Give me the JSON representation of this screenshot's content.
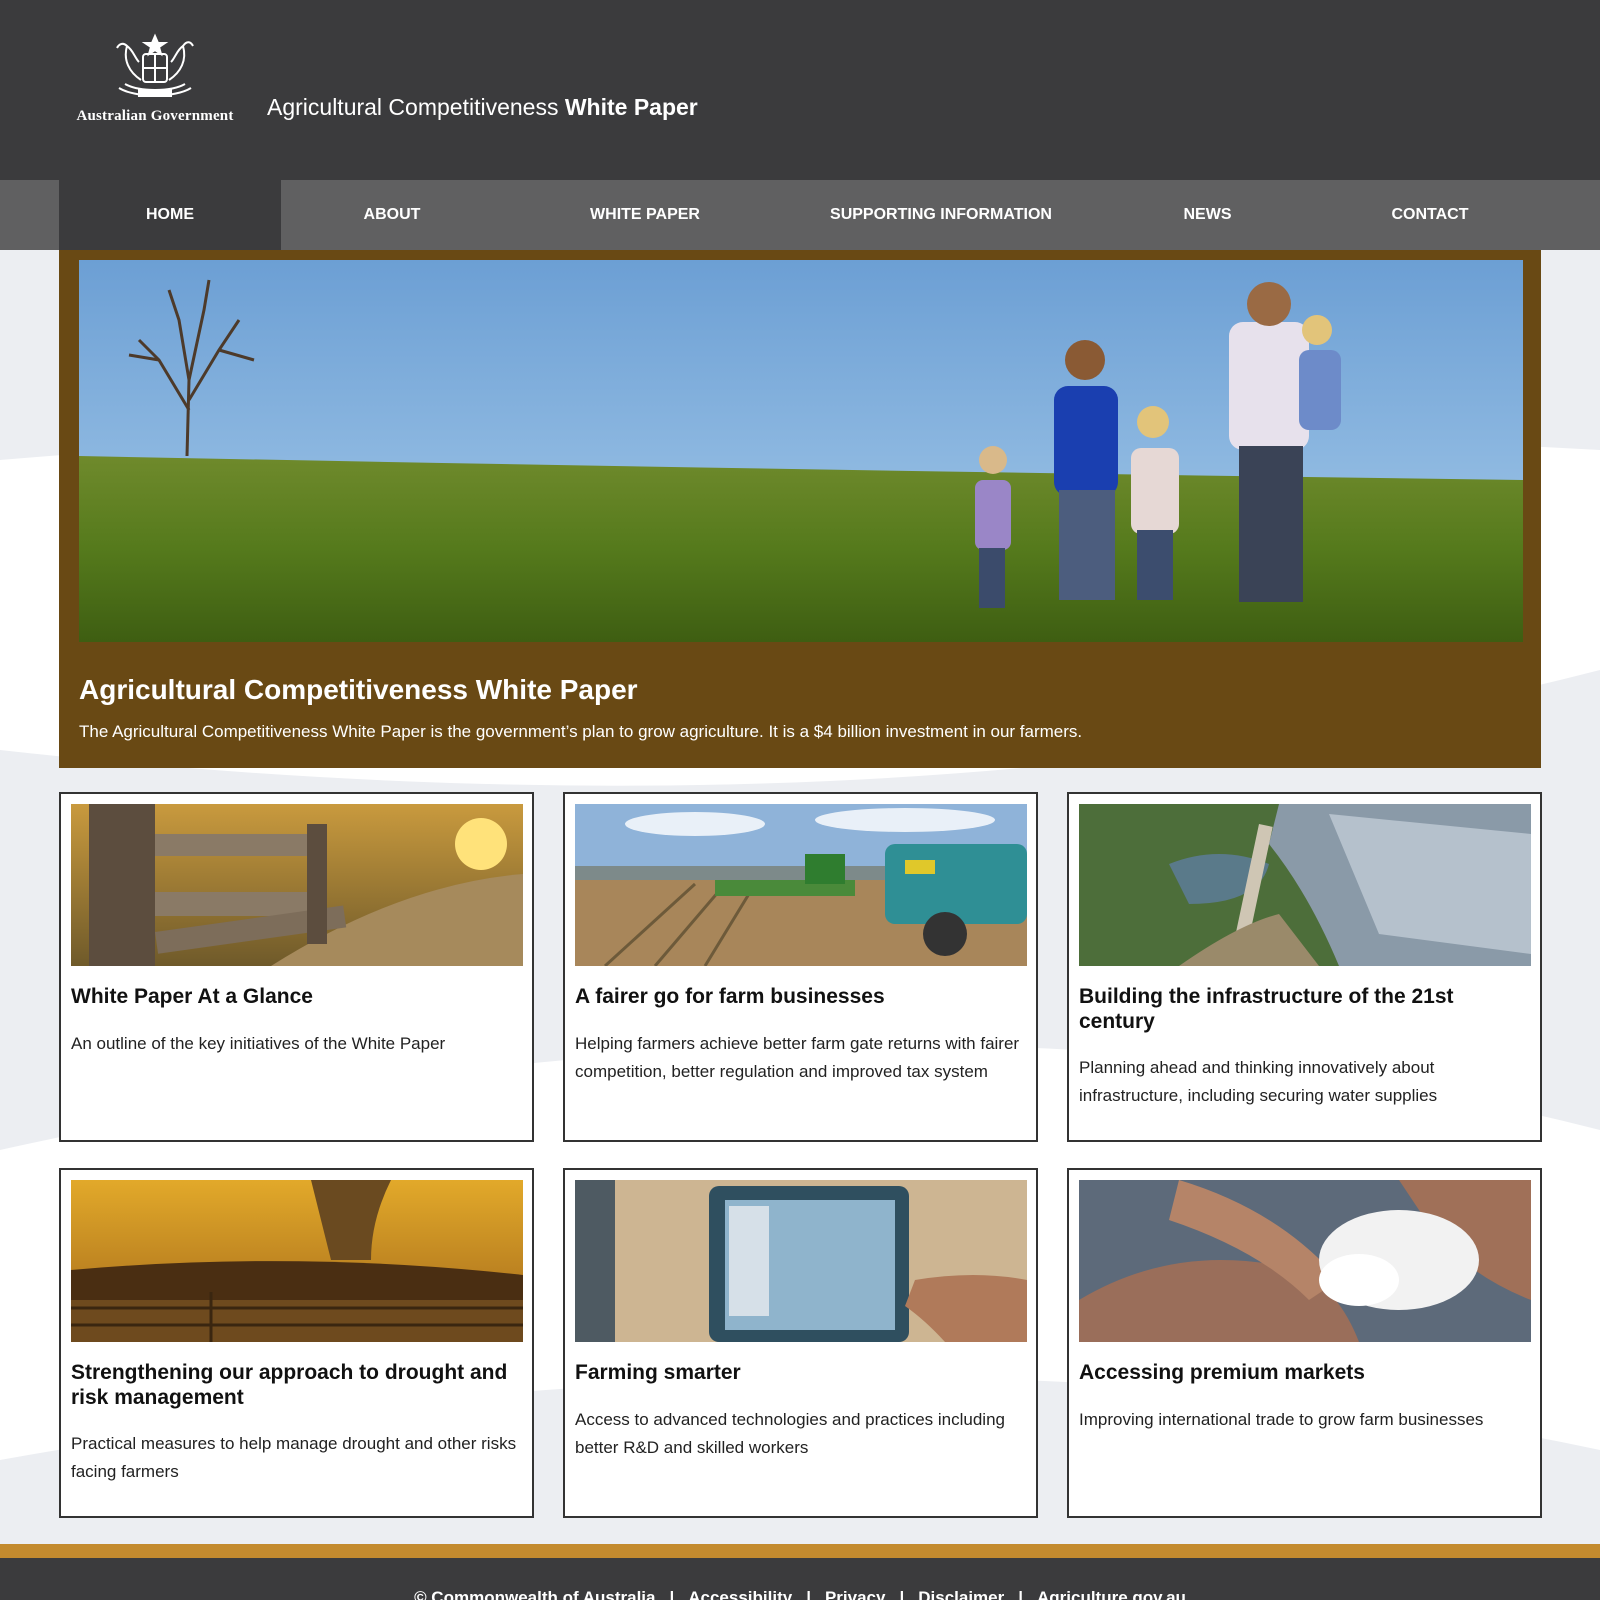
{
  "header": {
    "logo_text": "Australian Government",
    "site_title_regular": "Agricultural Competitiveness",
    "site_title_bold": "White Paper"
  },
  "nav": {
    "items": [
      {
        "label": "HOME",
        "active": true
      },
      {
        "label": "ABOUT"
      },
      {
        "label": "WHITE PAPER"
      },
      {
        "label": "SUPPORTING INFORMATION"
      },
      {
        "label": "NEWS"
      },
      {
        "label": "CONTACT"
      }
    ]
  },
  "hero": {
    "title": "Agricultural Competitiveness White Paper",
    "description": "The Agricultural Competitiveness White Paper is the government’s plan to grow agriculture. It is a $4 billion investment in our farmers."
  },
  "cards": [
    {
      "title": "White Paper At a Glance",
      "description": "An outline of the key initiatives of the White Paper"
    },
    {
      "title": "A fairer go for farm businesses",
      "description": "Helping farmers achieve better farm gate returns with fairer competition, better regulation and improved tax system"
    },
    {
      "title": "Building the infrastructure of the 21st century",
      "description": "Planning ahead and thinking innovatively about infrastructure, including securing water supplies"
    },
    {
      "title": "Strengthening our approach to drought and risk management",
      "description": "Practical measures to help manage drought and other risks facing farmers"
    },
    {
      "title": "Farming smarter",
      "description": "Access to advanced technologies and practices including better R&D and skilled workers"
    },
    {
      "title": "Accessing premium markets",
      "description": "Improving international trade to grow farm businesses"
    }
  ],
  "footer": {
    "links": [
      "© Commonwealth of Australia",
      "Accessibility",
      "Privacy",
      "Disclaimer",
      "Agriculture.gov.au"
    ],
    "separator": "|"
  },
  "colors": {
    "header_bg": "#3b3b3d",
    "nav_bg": "#606061",
    "hero_bg": "#694914",
    "footer_accent": "#c38a2e"
  }
}
